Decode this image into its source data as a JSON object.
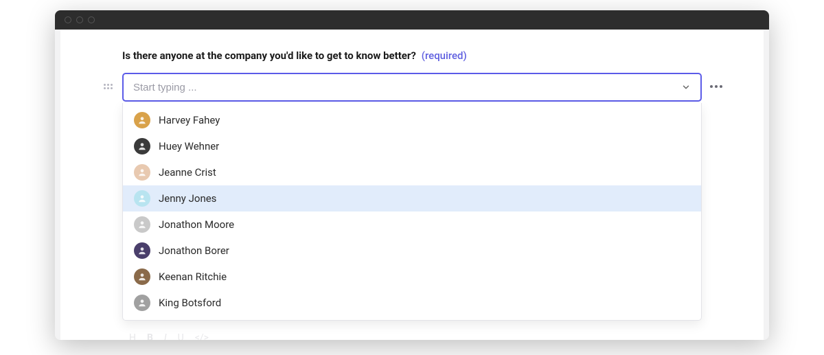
{
  "question": {
    "text": "Is there anyone at the company you'd like to get to know better?",
    "required_label": "(required)"
  },
  "select": {
    "placeholder": "Start typing ...",
    "value": ""
  },
  "options": [
    {
      "name": "Harvey Fahey",
      "avatar_bg": "#d9a24a",
      "highlighted": false
    },
    {
      "name": "Huey Wehner",
      "avatar_bg": "#3a3a3a",
      "highlighted": false
    },
    {
      "name": "Jeanne Crist",
      "avatar_bg": "#e8c9b0",
      "highlighted": false
    },
    {
      "name": "Jenny Jones",
      "avatar_bg": "#b8e4f0",
      "highlighted": true
    },
    {
      "name": "Jonathon Moore",
      "avatar_bg": "#c9c9c9",
      "highlighted": false
    },
    {
      "name": "Jonathon Borer",
      "avatar_bg": "#4a3f6b",
      "highlighted": false
    },
    {
      "name": "Keenan Ritchie",
      "avatar_bg": "#8a6a4a",
      "highlighted": false
    },
    {
      "name": "King Botsford",
      "avatar_bg": "#a0a0a0",
      "highlighted": false
    }
  ]
}
